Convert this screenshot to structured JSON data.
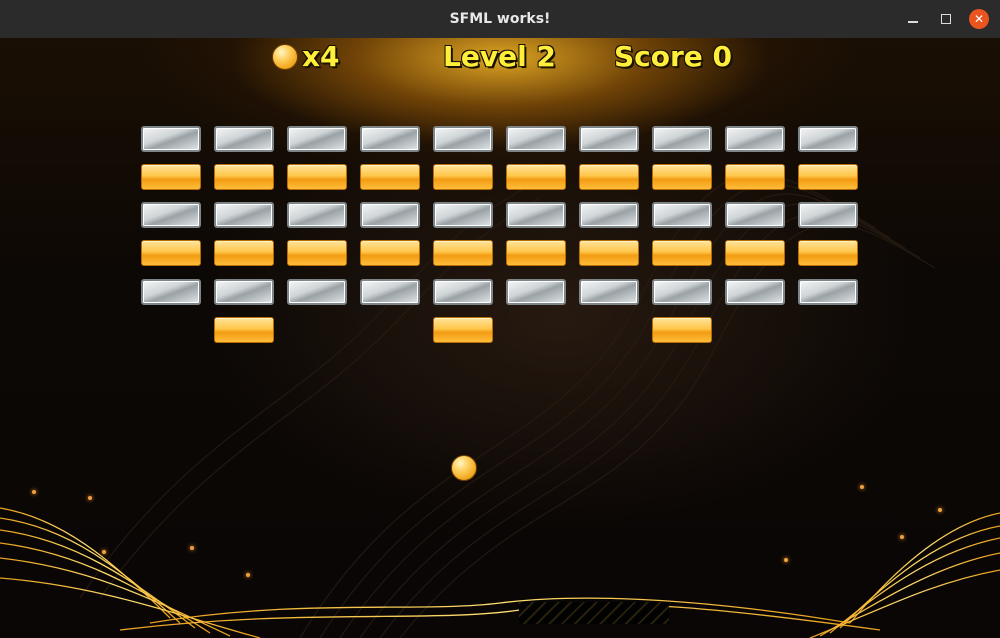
{
  "window": {
    "title": "SFML works!"
  },
  "hud": {
    "lives": "x4",
    "level": "Level 2",
    "score": "Score 0"
  },
  "bricks": {
    "columns": 10,
    "rows": [
      {
        "type": "silver",
        "present": [
          1,
          1,
          1,
          1,
          1,
          1,
          1,
          1,
          1,
          1
        ]
      },
      {
        "type": "gold",
        "present": [
          1,
          1,
          1,
          1,
          1,
          1,
          1,
          1,
          1,
          1
        ]
      },
      {
        "type": "silver",
        "present": [
          1,
          1,
          1,
          1,
          1,
          1,
          1,
          1,
          1,
          1
        ]
      },
      {
        "type": "gold",
        "present": [
          1,
          1,
          1,
          1,
          1,
          1,
          1,
          1,
          1,
          1
        ]
      },
      {
        "type": "silver",
        "present": [
          1,
          1,
          1,
          1,
          1,
          1,
          1,
          1,
          1,
          1
        ]
      },
      {
        "type": "gold",
        "present": [
          0,
          1,
          0,
          0,
          1,
          0,
          0,
          1,
          0,
          0
        ]
      }
    ]
  },
  "colors": {
    "hud_text": "#ffef3a",
    "gold_brick": "#ffc64a",
    "silver_brick": "#cfd4d6",
    "close_button": "#e9541f"
  },
  "icons": {
    "lives": "ball-icon",
    "minimize": "minimize-icon",
    "maximize": "maximize-icon",
    "close": "close-icon"
  }
}
